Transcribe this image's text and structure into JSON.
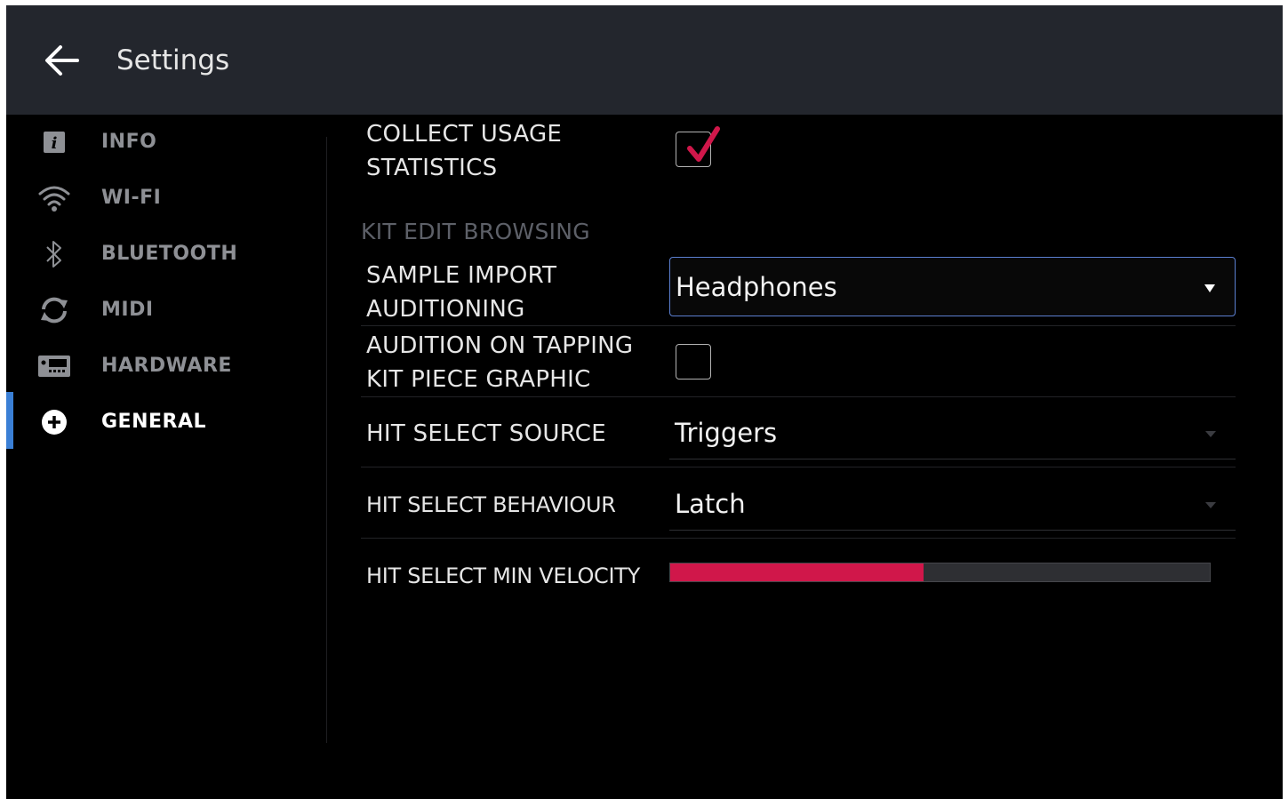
{
  "header": {
    "title": "Settings",
    "back_icon": "arrow-left-icon"
  },
  "sidebar": {
    "active": "GENERAL",
    "items": [
      {
        "label": "INFO",
        "icon": "info-icon"
      },
      {
        "label": "WI-FI",
        "icon": "wifi-icon"
      },
      {
        "label": "BLUETOOTH",
        "icon": "bluetooth-icon"
      },
      {
        "label": "MIDI",
        "icon": "midi-sync-icon"
      },
      {
        "label": "HARDWARE",
        "icon": "hardware-icon"
      },
      {
        "label": "GENERAL",
        "icon": "plus-circle-icon"
      }
    ]
  },
  "settings": {
    "collect_usage": {
      "label_line1": "COLLECT USAGE",
      "label_line2": "STATISTICS",
      "checked": true
    },
    "section_kit_edit": "KIT EDIT BROWSING",
    "sample_import": {
      "label_line1": "SAMPLE IMPORT",
      "label_line2": "AUDITIONING",
      "value": "Headphones"
    },
    "audition_tapping": {
      "label_line1": "AUDITION ON TAPPING",
      "label_line2": "KIT PIECE GRAPHIC",
      "checked": false
    },
    "hit_select_source": {
      "label": "HIT SELECT SOURCE",
      "value": "Triggers"
    },
    "hit_select_behaviour": {
      "label": "HIT SELECT BEHAVIOUR",
      "value": "Latch"
    },
    "hit_select_min_velocity": {
      "label": "HIT SELECT MIN VELOCITY",
      "value_fraction": 0.47
    }
  },
  "colors": {
    "accent_red": "#d0174a",
    "active_indicator": "#3a7fd5",
    "topbar": "#23262d",
    "focus_border": "#5b7fd0"
  }
}
